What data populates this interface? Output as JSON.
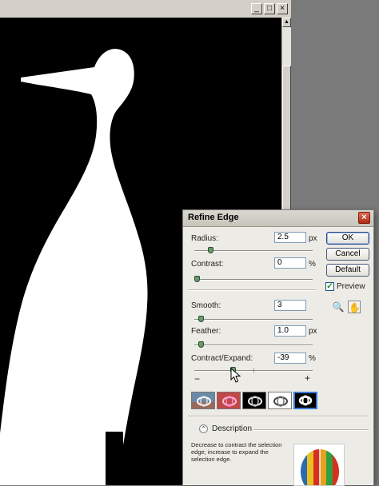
{
  "document_window": {
    "controls": {
      "minimize": "_",
      "maximize": "□",
      "close": "×"
    }
  },
  "dialog": {
    "title": "Refine Edge",
    "close_glyph": "×",
    "params": {
      "radius": {
        "label": "Radius:",
        "value": "2.5",
        "unit": "px",
        "slider": 0.12
      },
      "contrast": {
        "label": "Contrast:",
        "value": "0",
        "unit": "%",
        "slider": 0.0
      },
      "smooth": {
        "label": "Smooth:",
        "value": "3",
        "unit": "",
        "slider": 0.04
      },
      "feather": {
        "label": "Feather:",
        "value": "1.0",
        "unit": "px",
        "slider": 0.04
      },
      "contract_expand": {
        "label": "Contract/Expand:",
        "value": "-39",
        "unit": "%",
        "slider": 0.31,
        "minus": "−",
        "plus": "+"
      }
    },
    "buttons": {
      "ok": "OK",
      "cancel": "Cancel",
      "default": "Default"
    },
    "preview": {
      "label": "Preview",
      "checked": true,
      "check_glyph": "✓"
    },
    "tools": {
      "zoom_icon": "zoom-icon",
      "zoom_glyph": "🔍",
      "hand_icon": "hand-icon",
      "hand_glyph": "✋"
    },
    "view_modes": [
      "standard",
      "quick-mask",
      "on-black",
      "on-white",
      "mask"
    ],
    "description": {
      "toggle_glyph": "⌃",
      "label": "Description",
      "text": "Decrease to contract the selection edge; increase to expand the selection edge."
    }
  }
}
